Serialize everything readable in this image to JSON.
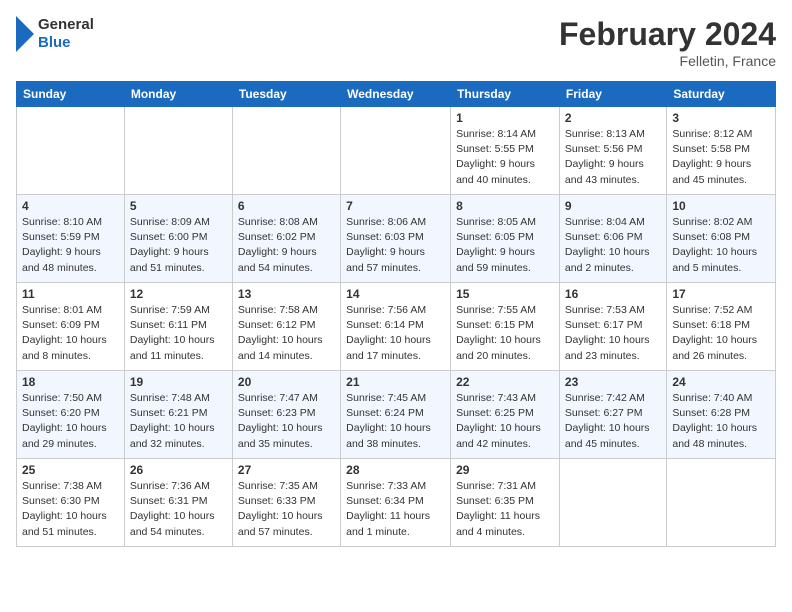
{
  "header": {
    "logo_line1": "General",
    "logo_line2": "Blue",
    "month": "February 2024",
    "location": "Felletin, France"
  },
  "days_of_week": [
    "Sunday",
    "Monday",
    "Tuesday",
    "Wednesday",
    "Thursday",
    "Friday",
    "Saturday"
  ],
  "weeks": [
    [
      {
        "day": "",
        "info": ""
      },
      {
        "day": "",
        "info": ""
      },
      {
        "day": "",
        "info": ""
      },
      {
        "day": "",
        "info": ""
      },
      {
        "day": "1",
        "info": "Sunrise: 8:14 AM\nSunset: 5:55 PM\nDaylight: 9 hours and 40 minutes."
      },
      {
        "day": "2",
        "info": "Sunrise: 8:13 AM\nSunset: 5:56 PM\nDaylight: 9 hours and 43 minutes."
      },
      {
        "day": "3",
        "info": "Sunrise: 8:12 AM\nSunset: 5:58 PM\nDaylight: 9 hours and 45 minutes."
      }
    ],
    [
      {
        "day": "4",
        "info": "Sunrise: 8:10 AM\nSunset: 5:59 PM\nDaylight: 9 hours and 48 minutes."
      },
      {
        "day": "5",
        "info": "Sunrise: 8:09 AM\nSunset: 6:00 PM\nDaylight: 9 hours and 51 minutes."
      },
      {
        "day": "6",
        "info": "Sunrise: 8:08 AM\nSunset: 6:02 PM\nDaylight: 9 hours and 54 minutes."
      },
      {
        "day": "7",
        "info": "Sunrise: 8:06 AM\nSunset: 6:03 PM\nDaylight: 9 hours and 57 minutes."
      },
      {
        "day": "8",
        "info": "Sunrise: 8:05 AM\nSunset: 6:05 PM\nDaylight: 9 hours and 59 minutes."
      },
      {
        "day": "9",
        "info": "Sunrise: 8:04 AM\nSunset: 6:06 PM\nDaylight: 10 hours and 2 minutes."
      },
      {
        "day": "10",
        "info": "Sunrise: 8:02 AM\nSunset: 6:08 PM\nDaylight: 10 hours and 5 minutes."
      }
    ],
    [
      {
        "day": "11",
        "info": "Sunrise: 8:01 AM\nSunset: 6:09 PM\nDaylight: 10 hours and 8 minutes."
      },
      {
        "day": "12",
        "info": "Sunrise: 7:59 AM\nSunset: 6:11 PM\nDaylight: 10 hours and 11 minutes."
      },
      {
        "day": "13",
        "info": "Sunrise: 7:58 AM\nSunset: 6:12 PM\nDaylight: 10 hours and 14 minutes."
      },
      {
        "day": "14",
        "info": "Sunrise: 7:56 AM\nSunset: 6:14 PM\nDaylight: 10 hours and 17 minutes."
      },
      {
        "day": "15",
        "info": "Sunrise: 7:55 AM\nSunset: 6:15 PM\nDaylight: 10 hours and 20 minutes."
      },
      {
        "day": "16",
        "info": "Sunrise: 7:53 AM\nSunset: 6:17 PM\nDaylight: 10 hours and 23 minutes."
      },
      {
        "day": "17",
        "info": "Sunrise: 7:52 AM\nSunset: 6:18 PM\nDaylight: 10 hours and 26 minutes."
      }
    ],
    [
      {
        "day": "18",
        "info": "Sunrise: 7:50 AM\nSunset: 6:20 PM\nDaylight: 10 hours and 29 minutes."
      },
      {
        "day": "19",
        "info": "Sunrise: 7:48 AM\nSunset: 6:21 PM\nDaylight: 10 hours and 32 minutes."
      },
      {
        "day": "20",
        "info": "Sunrise: 7:47 AM\nSunset: 6:23 PM\nDaylight: 10 hours and 35 minutes."
      },
      {
        "day": "21",
        "info": "Sunrise: 7:45 AM\nSunset: 6:24 PM\nDaylight: 10 hours and 38 minutes."
      },
      {
        "day": "22",
        "info": "Sunrise: 7:43 AM\nSunset: 6:25 PM\nDaylight: 10 hours and 42 minutes."
      },
      {
        "day": "23",
        "info": "Sunrise: 7:42 AM\nSunset: 6:27 PM\nDaylight: 10 hours and 45 minutes."
      },
      {
        "day": "24",
        "info": "Sunrise: 7:40 AM\nSunset: 6:28 PM\nDaylight: 10 hours and 48 minutes."
      }
    ],
    [
      {
        "day": "25",
        "info": "Sunrise: 7:38 AM\nSunset: 6:30 PM\nDaylight: 10 hours and 51 minutes."
      },
      {
        "day": "26",
        "info": "Sunrise: 7:36 AM\nSunset: 6:31 PM\nDaylight: 10 hours and 54 minutes."
      },
      {
        "day": "27",
        "info": "Sunrise: 7:35 AM\nSunset: 6:33 PM\nDaylight: 10 hours and 57 minutes."
      },
      {
        "day": "28",
        "info": "Sunrise: 7:33 AM\nSunset: 6:34 PM\nDaylight: 11 hours and 1 minute."
      },
      {
        "day": "29",
        "info": "Sunrise: 7:31 AM\nSunset: 6:35 PM\nDaylight: 11 hours and 4 minutes."
      },
      {
        "day": "",
        "info": ""
      },
      {
        "day": "",
        "info": ""
      }
    ]
  ]
}
